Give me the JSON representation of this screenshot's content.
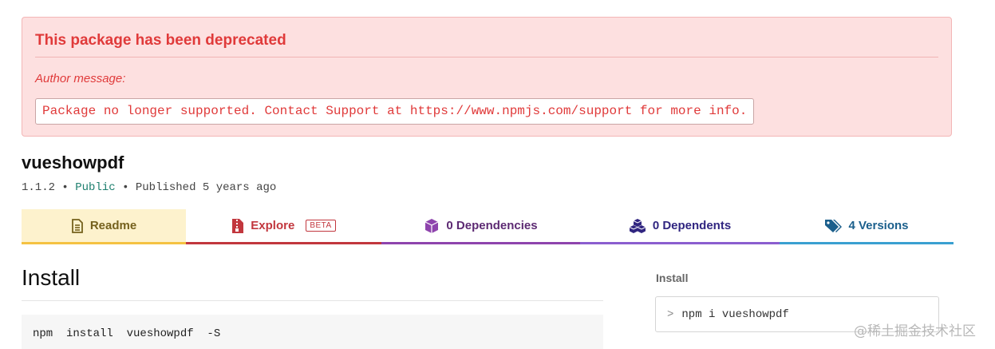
{
  "deprecation": {
    "title": "This package has been deprecated",
    "author_label": "Author message:",
    "message": "Package no longer supported. Contact Support at https://www.npmjs.com/support for more info."
  },
  "package": {
    "name": "vueshowpdf",
    "version": "1.1.2",
    "separator": "•",
    "visibility": "Public",
    "published": "Published 5 years ago"
  },
  "tabs": [
    {
      "label": "Readme",
      "icon": "document-icon",
      "active": true,
      "color": "#75611d"
    },
    {
      "label": "Explore",
      "icon": "zip-file-icon",
      "badge": "BETA",
      "color": "#c2373e"
    },
    {
      "label": "0 Dependencies",
      "icon": "cube-icon",
      "color": "#5d2a73"
    },
    {
      "label": "0 Dependents",
      "icon": "cubes-icon",
      "color": "#302580"
    },
    {
      "label": "4 Versions",
      "icon": "tags-icon",
      "color": "#1b5f8c"
    }
  ],
  "readme": {
    "heading": "Install",
    "code": "npm  install  vueshowpdf  -S"
  },
  "sidebar": {
    "install_label": "Install",
    "install_prompt": ">",
    "install_command": "npm i vueshowpdf"
  },
  "watermark": "@稀土掘金技术社区"
}
